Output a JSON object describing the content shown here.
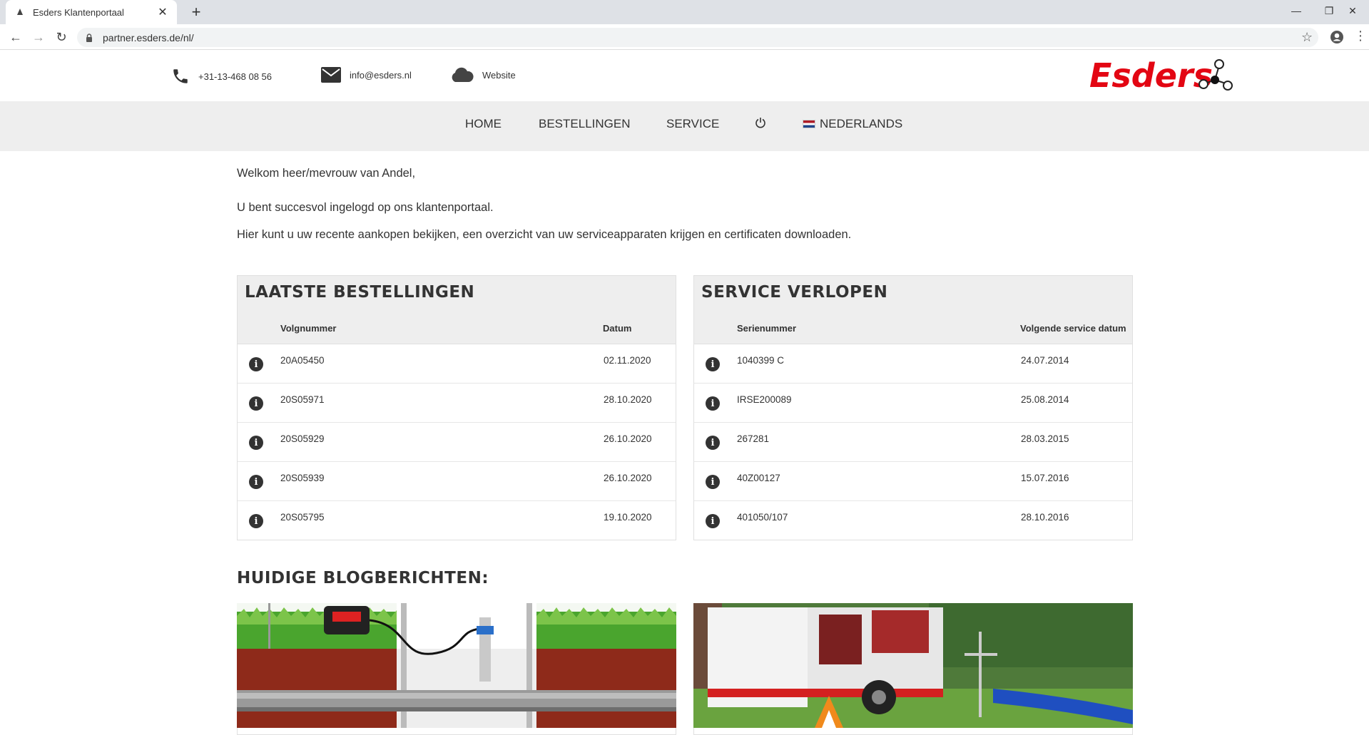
{
  "browser": {
    "tab_title": "Esders Klantenportaal",
    "url": "partner.esders.de/nl/"
  },
  "contact": {
    "phone": "+31-13-468 08 56",
    "email": "info@esders.nl",
    "website": "Website"
  },
  "logo_text": "Esders",
  "nav": {
    "home": "HOME",
    "orders": "BESTELLINGEN",
    "service": "SERVICE",
    "language": "NEDERLANDS"
  },
  "welcome": {
    "greeting": "Welkom heer/mevrouw van Andel,",
    "line1": "U bent succesvol ingelogd op ons klantenportaal.",
    "line2": "Hier kunt u uw recente aankopen bekijken, een overzicht van uw serviceapparaten krijgen en certificaten downloaden."
  },
  "orders": {
    "title": "LAATSTE BESTELLINGEN",
    "col1": "Volgnummer",
    "col2": "Datum",
    "rows": [
      {
        "id": "20A05450",
        "date": "02.11.2020"
      },
      {
        "id": "20S05971",
        "date": "28.10.2020"
      },
      {
        "id": "20S05929",
        "date": "26.10.2020"
      },
      {
        "id": "20S05939",
        "date": "26.10.2020"
      },
      {
        "id": "20S05795",
        "date": "19.10.2020"
      }
    ]
  },
  "service": {
    "title": "SERVICE VERLOPEN",
    "col1": "Serienummer",
    "col2": "Volgende service datum",
    "rows": [
      {
        "id": "1040399 C",
        "date": "24.07.2014"
      },
      {
        "id": "IRSE200089",
        "date": "25.08.2014"
      },
      {
        "id": "267281",
        "date": "28.03.2015"
      },
      {
        "id": "40Z00127",
        "date": "15.07.2016"
      },
      {
        "id": "401050/107",
        "date": "28.10.2016"
      }
    ]
  },
  "blog": {
    "title": "HUIDIGE BLOGBERICHTEN:"
  },
  "colors": {
    "brand_red": "#e30613",
    "nav_bg": "#eeeeee",
    "text": "#333333"
  }
}
